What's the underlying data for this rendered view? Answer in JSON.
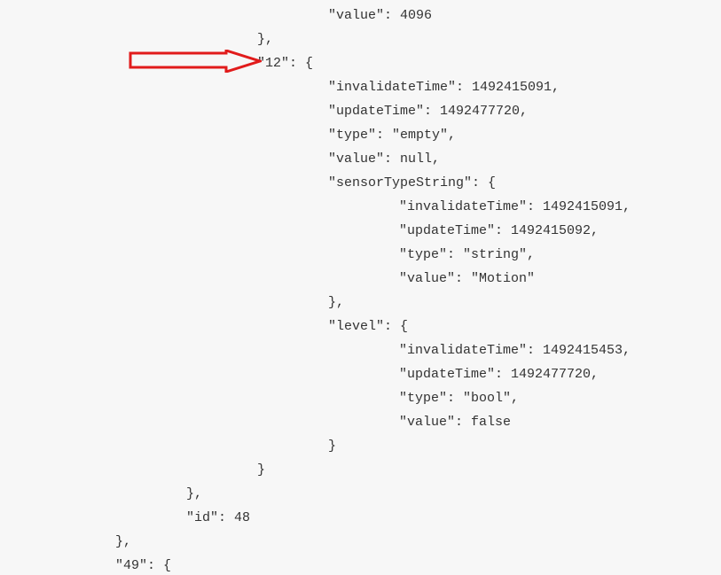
{
  "annotation": {
    "arrowColor": "#e11b1b"
  },
  "lines": [
    {
      "indent": 3,
      "text": "\"value\": 4096"
    },
    {
      "indent": 2,
      "text": "},"
    },
    {
      "indent": 2,
      "text": "\"12\": {"
    },
    {
      "indent": 3,
      "text": "\"invalidateTime\": 1492415091,"
    },
    {
      "indent": 3,
      "text": "\"updateTime\": 1492477720,"
    },
    {
      "indent": 3,
      "text": "\"type\": \"empty\","
    },
    {
      "indent": 3,
      "text": "\"value\": null,"
    },
    {
      "indent": 3,
      "text": "\"sensorTypeString\": {"
    },
    {
      "indent": 4,
      "text": "\"invalidateTime\": 1492415091,"
    },
    {
      "indent": 4,
      "text": "\"updateTime\": 1492415092,"
    },
    {
      "indent": 4,
      "text": "\"type\": \"string\","
    },
    {
      "indent": 4,
      "text": "\"value\": \"Motion\""
    },
    {
      "indent": 3,
      "text": "},"
    },
    {
      "indent": 3,
      "text": "\"level\": {"
    },
    {
      "indent": 4,
      "text": "\"invalidateTime\": 1492415453,"
    },
    {
      "indent": 4,
      "text": "\"updateTime\": 1492477720,"
    },
    {
      "indent": 4,
      "text": "\"type\": \"bool\","
    },
    {
      "indent": 4,
      "text": "\"value\": false"
    },
    {
      "indent": 3,
      "text": "}"
    },
    {
      "indent": 2,
      "text": "}"
    },
    {
      "indent": 1,
      "text": "},"
    },
    {
      "indent": 1,
      "text": "\"id\": 48"
    },
    {
      "indent": 0,
      "text": "},"
    },
    {
      "indent": 0,
      "text": "\"49\": {"
    }
  ]
}
